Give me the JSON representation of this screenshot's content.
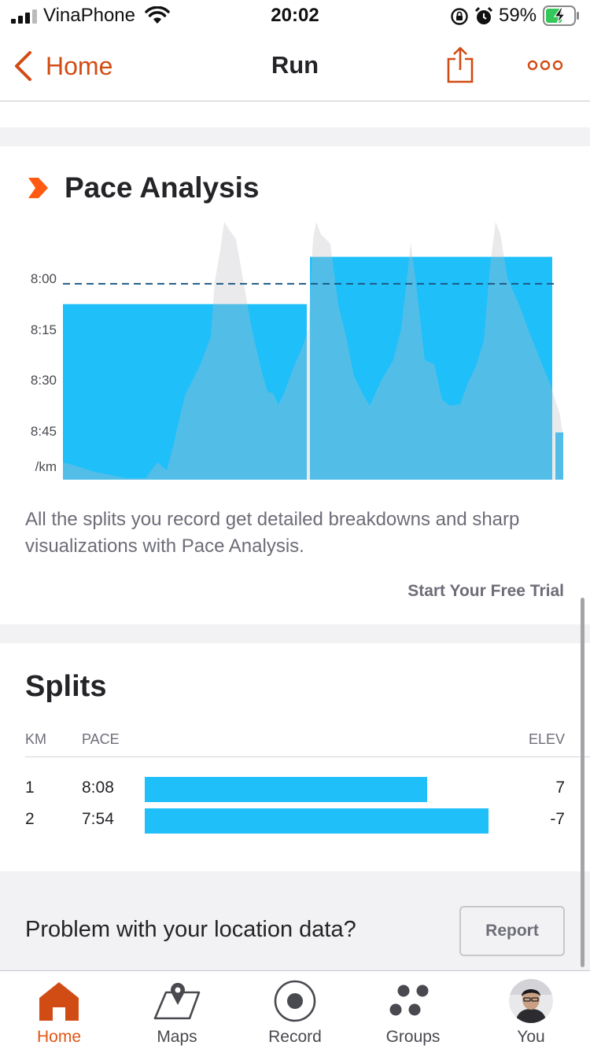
{
  "status_bar": {
    "carrier": "VinaPhone",
    "time": "20:02",
    "battery_percent": "59%",
    "battery_level": 0.59
  },
  "nav": {
    "back_label": "Home",
    "title": "Run",
    "accent_color": "#d14c14"
  },
  "pace_analysis": {
    "title": "Pace Analysis",
    "description": "All the splits you record get detailed breakdowns and sharp visualizations with Pace Analysis.",
    "cta_label": "Start Your Free Trial"
  },
  "chart_data": {
    "type": "bar",
    "title": "Pace Analysis",
    "ylabel": "/km",
    "y_ticks": [
      "8:00",
      "8:15",
      "8:30",
      "8:45"
    ],
    "y_ticks_seconds_per_km": [
      480,
      495,
      510,
      525
    ],
    "ylim_seconds_per_km": [
      540,
      472
    ],
    "inverted_y": true,
    "categories": [
      "1",
      "2",
      "3"
    ],
    "series": [
      {
        "values_pace": [
          "8:08",
          "7:54",
          "8:46"
        ],
        "values_seconds_per_km": [
          488,
          474,
          526
        ],
        "color": "#1fbffa"
      }
    ],
    "average_line_seconds_per_km": 482,
    "average_line_style": "dashed",
    "elevation_profile_color": "#bdbdc4",
    "grid": false
  },
  "splits": {
    "title": "Splits",
    "headers": {
      "km": "KM",
      "pace": "PACE",
      "elev": "ELEV"
    },
    "bar_color": "#1fbffa",
    "rows": [
      {
        "km": "1",
        "pace": "8:08",
        "elev": "7",
        "bar_fraction": 0.78
      },
      {
        "km": "2",
        "pace": "7:54",
        "elev": "-7",
        "bar_fraction": 0.95
      }
    ]
  },
  "location": {
    "question": "Problem with your location data?",
    "button_label": "Report"
  },
  "tab_bar": {
    "active_color": "#e05616",
    "tabs": [
      {
        "label": "Home",
        "icon": "home-icon",
        "active": true
      },
      {
        "label": "Maps",
        "icon": "map-icon",
        "active": false
      },
      {
        "label": "Record",
        "icon": "record-icon",
        "active": false
      },
      {
        "label": "Groups",
        "icon": "groups-icon",
        "active": false
      },
      {
        "label": "You",
        "icon": "avatar",
        "active": false
      }
    ]
  }
}
